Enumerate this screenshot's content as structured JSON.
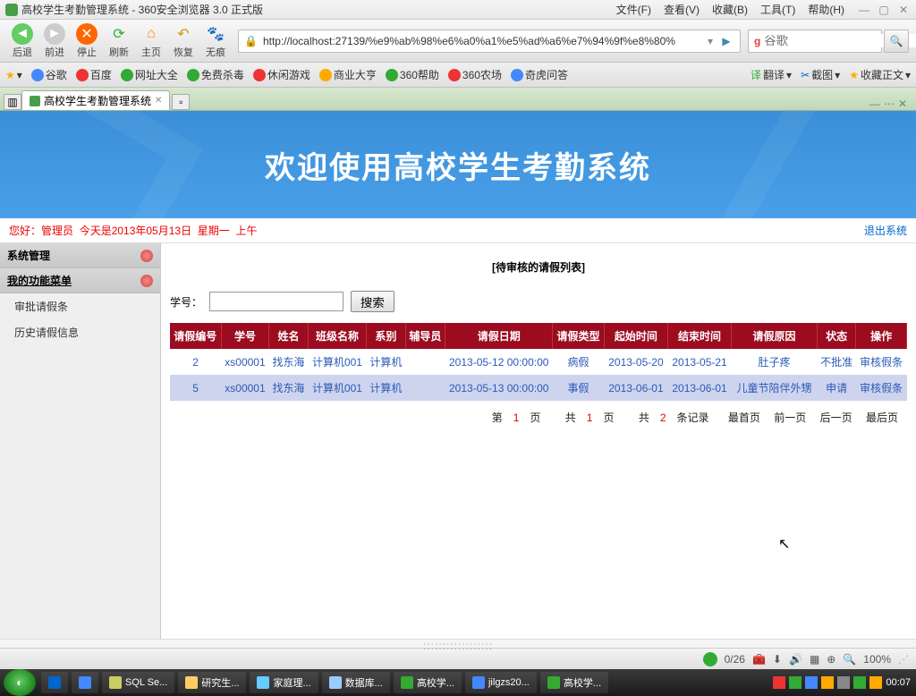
{
  "window": {
    "title": "高校学生考勤管理系统 - 360安全浏览器 3.0 正式版",
    "menus": [
      "文件(F)",
      "查看(V)",
      "收藏(B)",
      "工具(T)",
      "帮助(H)"
    ]
  },
  "nav": {
    "back": "后退",
    "forward": "前进",
    "stop": "停止",
    "refresh": "刷新",
    "home": "主页",
    "restore": "恢复",
    "incognito": "无痕",
    "url": "http://localhost:27139/%e9%ab%98%e6%a0%a1%e5%ad%a6%e7%94%9f%e8%80%",
    "search_placeholder": "谷歌"
  },
  "bookmarks": [
    "谷歌",
    "百度",
    "网址大全",
    "免费杀毒",
    "休闲游戏",
    "商业大亨",
    "360帮助",
    "360农场",
    "奇虎问答"
  ],
  "bookmarks_right": [
    "翻译",
    "截图",
    "收藏正文"
  ],
  "tab": {
    "title": "高校学生考勤管理系统"
  },
  "banner": "欢迎使用高校学生考勤系统",
  "statusline": {
    "hello": "您好：管理员",
    "date": "今天是2013年05月13日",
    "weekday": "星期一",
    "ampm": "上午",
    "logout": "退出系统"
  },
  "sidebar": {
    "group1": "系统管理",
    "group2": "我的功能菜单",
    "items": [
      "审批请假条",
      "历史请假信息"
    ]
  },
  "list": {
    "title": "[待审核的请假列表]",
    "search_label": "学号：",
    "search_btn": "搜索"
  },
  "table": {
    "headers": [
      "请假编号",
      "学号",
      "姓名",
      "班级名称",
      "系别",
      "辅导员",
      "请假日期",
      "请假类型",
      "起始时间",
      "结束时间",
      "请假原因",
      "状态",
      "操作"
    ],
    "rows": [
      {
        "id": "2",
        "sid": "xs00001",
        "name": "找东海",
        "cls": "计算机001",
        "dept": "计算机",
        "tutor": "",
        "date": "2013-05-12 00:00:00",
        "type": "病假",
        "start": "2013-05-20",
        "end": "2013-05-21",
        "reason": "肚子疼",
        "status": "不批准",
        "action": "审核假条"
      },
      {
        "id": "5",
        "sid": "xs00001",
        "name": "找东海",
        "cls": "计算机001",
        "dept": "计算机",
        "tutor": "",
        "date": "2013-05-13 00:00:00",
        "type": "事假",
        "start": "2013-06-01",
        "end": "2013-06-01",
        "reason": "儿童节陪伴外甥",
        "status": "申请",
        "action": "审核假条"
      }
    ]
  },
  "pager": {
    "p1a": "第",
    "p1b": "页",
    "p2a": "共",
    "p2b": "页",
    "p3a": "共",
    "p3b": "条记录",
    "pn": "1",
    "tp": "1",
    "tr": "2",
    "first": "最首页",
    "prev": "前一页",
    "next": "后一页",
    "last": "最后页"
  },
  "statusbar": {
    "count": "0/26",
    "zoom": "100%"
  },
  "taskbar": {
    "items": [
      "SQL Se...",
      "研究生...",
      "家庭理...",
      "数据库...",
      "高校学...",
      "jilgzs20...",
      "高校学..."
    ],
    "time": "00:07"
  }
}
